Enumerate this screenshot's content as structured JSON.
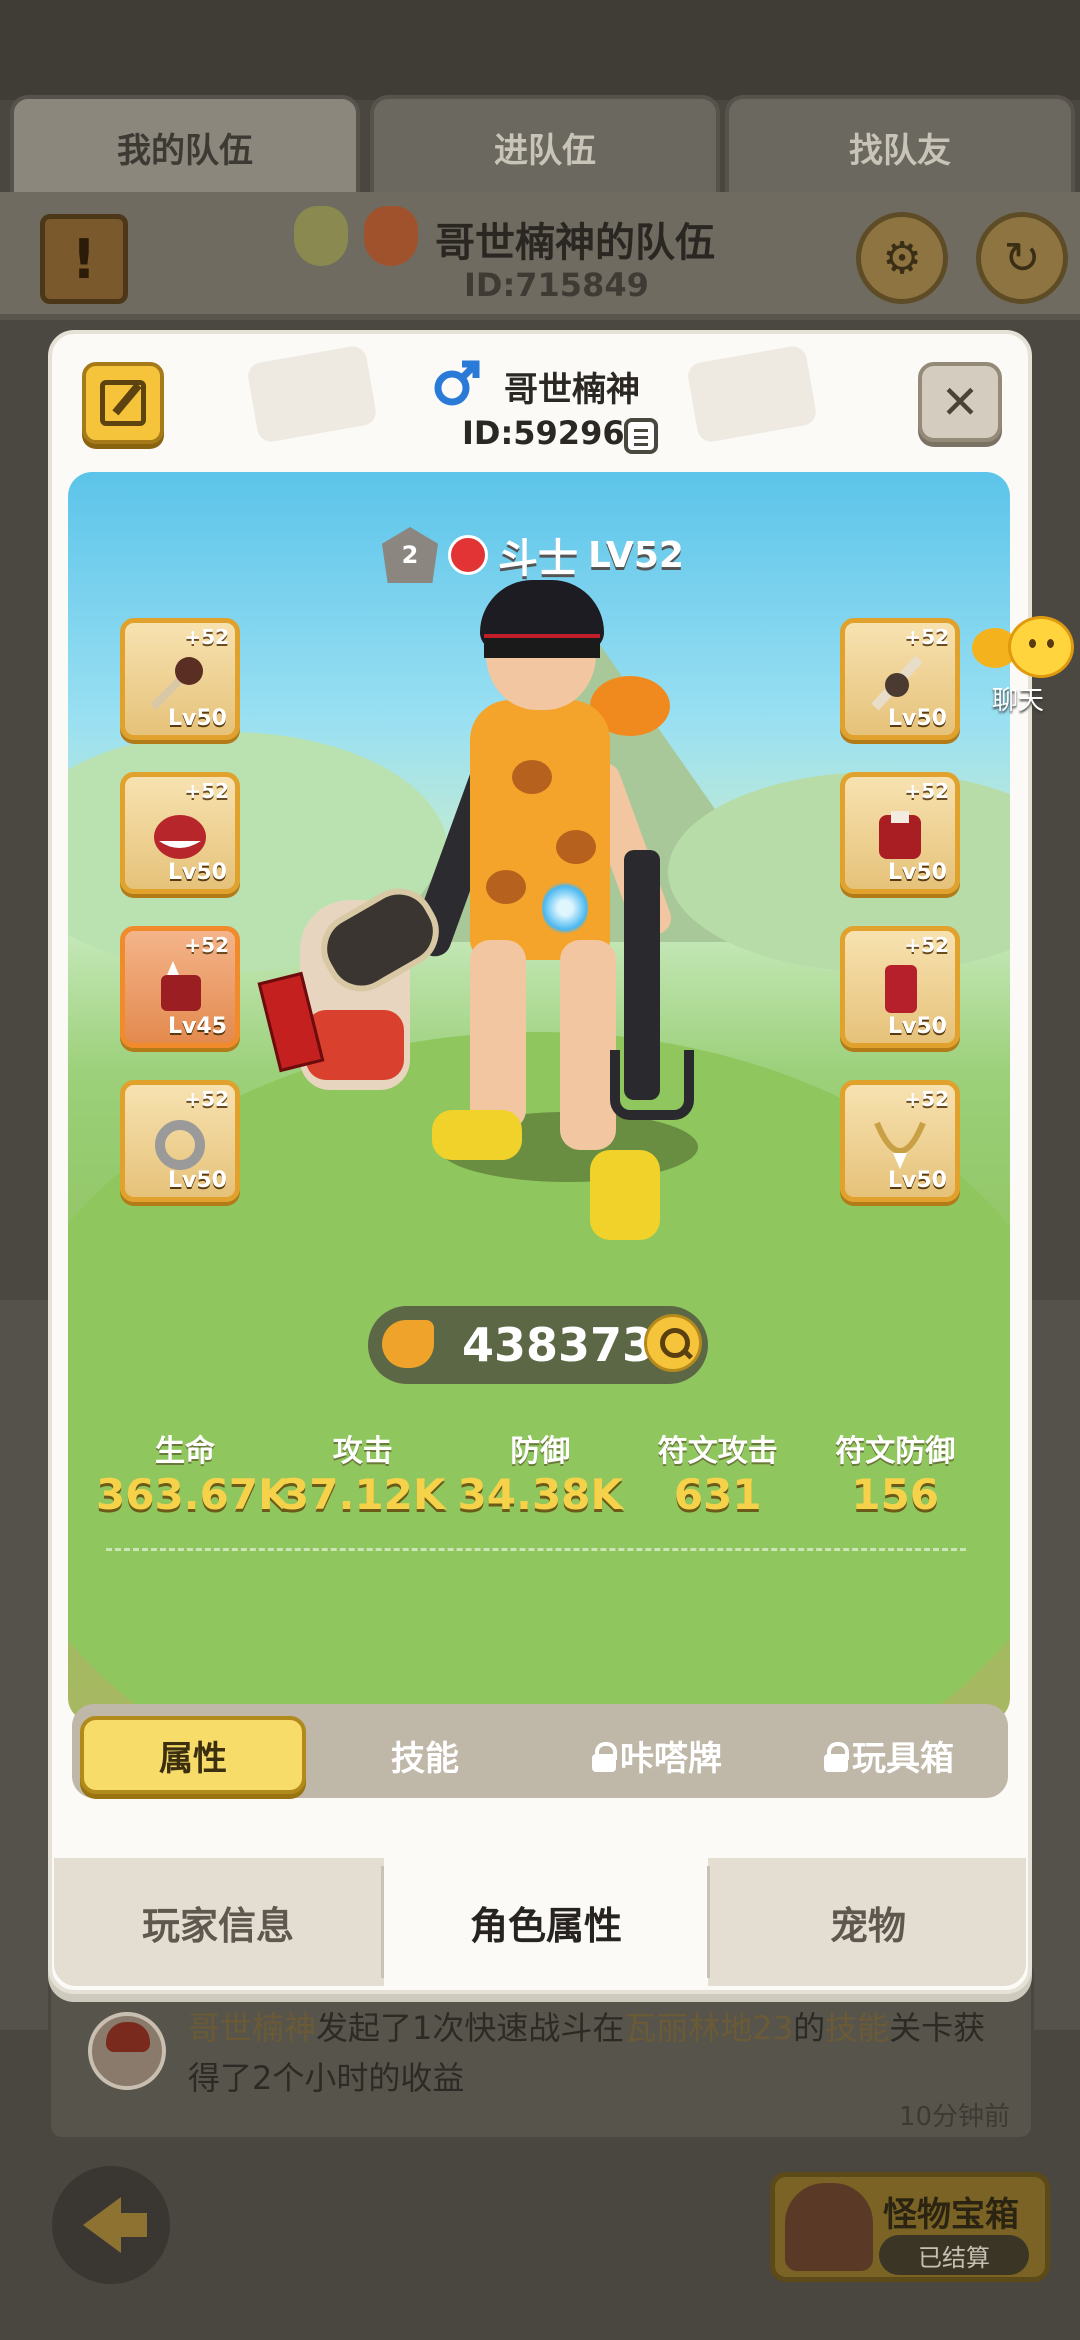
{
  "tabs": [
    "我的队伍",
    "进队伍",
    "找队友"
  ],
  "team": {
    "name": "哥世楠神的队伍",
    "id": "ID:715849"
  },
  "player": {
    "name": "哥世楠神",
    "id": "ID:592969",
    "class_name": "斗士",
    "level": "LV52",
    "rank": "2"
  },
  "equipment": {
    "left": [
      {
        "plus": "+52",
        "lv": "Lv50"
      },
      {
        "plus": "+52",
        "lv": "Lv50"
      },
      {
        "plus": "+52",
        "lv": "Lv45"
      },
      {
        "plus": "+52",
        "lv": "Lv50"
      }
    ],
    "right": [
      {
        "plus": "+52",
        "lv": "Lv50"
      },
      {
        "plus": "+52",
        "lv": "Lv50"
      },
      {
        "plus": "+52",
        "lv": "Lv50"
      },
      {
        "plus": "+52",
        "lv": "Lv50"
      }
    ]
  },
  "chat_label": "聊天",
  "power": "438373",
  "stats": [
    {
      "label": "生命",
      "value": "363.67K"
    },
    {
      "label": "攻击",
      "value": "37.12K"
    },
    {
      "label": "防御",
      "value": "34.38K"
    },
    {
      "label": "符文攻击",
      "value": "631"
    },
    {
      "label": "符文防御",
      "value": "156"
    }
  ],
  "subtabs": [
    "属性",
    "技能",
    "咔嗒牌",
    "玩具箱"
  ],
  "bottom_tabs": [
    "玩家信息",
    "角色属性",
    "宠物"
  ],
  "log": {
    "name": "哥世楠神",
    "t1": "发起了1次快速战斗在",
    "place": "瓦丽林地23",
    "t2": "的",
    "kind": "技能",
    "t3": "关卡获得了2个小时的收益",
    "time": "10分钟前"
  },
  "chest": {
    "title": "怪物宝箱",
    "status": "已结算"
  },
  "colors": {
    "accent": "#f6c43b",
    "stat_value": "#f6d24a",
    "modal_bg": "#fbfaf6"
  }
}
